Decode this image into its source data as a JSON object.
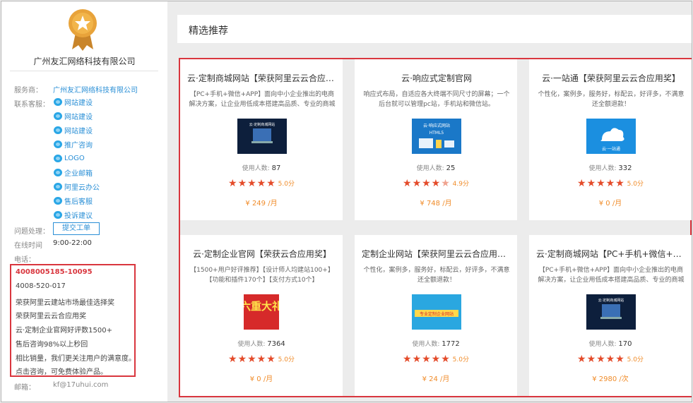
{
  "sidebar": {
    "company_name": "广州友汇网络科技有限公司",
    "provider_label": "服务商：",
    "provider_value": "广州友汇网络科技有限公司",
    "support_label": "联系客服：",
    "support_items": [
      "网站建设",
      "网站建设",
      "网站建设",
      "推广咨询",
      "LOGO",
      "企业邮箱",
      "阿里云办公",
      "售后客服",
      "投诉建议"
    ],
    "issue_label": "问题处理：",
    "ticket_button": "提交工单",
    "online_label": "在线时间",
    "online_value": "9:00-22:00",
    "phone_label": "电话：",
    "phone_lines": [
      "4008005185-10095",
      "4008-520-017",
      "荣获阿里云建站市场最佳选择奖",
      "荣获阿里云云合应用奖",
      "云·定制企业官网好评数1500+",
      "售后咨询98%以上秒回",
      "相比销量，我们更关注用户的满意度。",
      "点击咨询，可免费体验产品。"
    ],
    "email_label": "邮箱：",
    "email_value": "kf@17uhui.com"
  },
  "main": {
    "title": "精选推荐",
    "users_label": "使用人数:",
    "products": [
      {
        "title": "云·定制商城网站【荣获阿里云云合应用奖】",
        "desc": "【PC+手机+微信+APP】面向中小企业推出的电商解决方案，让企业用低成本搭建高品质、专业的商城",
        "users": "87",
        "score": "5.0分",
        "price": "¥ 249 /月",
        "rating": 5.0,
        "img_text": "云·定制商城网站"
      },
      {
        "title": "云·响应式定制官网",
        "desc": "响应式布局，自适应各大终端不同尺寸的屏幕；一个后台就可以管理pc站，手机站和微信站。",
        "users": "25",
        "score": "4.9分",
        "price": "¥ 748 /月",
        "rating": 4.9,
        "img_text": "云·响应式网站",
        "img_sub": "HTML5"
      },
      {
        "title": "云·一站通【荣获阿里云云合应用奖】",
        "desc": "个性化，案例多，服务好，标配云，好评多，不满意还全额退款！",
        "users": "332",
        "score": "5.0分",
        "price": "¥ 0 /月",
        "rating": 5.0,
        "img_text": "云·一站通"
      },
      {
        "title": "云·定制企业官网【荣获云合应用奖】",
        "desc": "【1500+用户好评推荐】【设计师人均建站100+】【功能和插件170个】【支付方式10个】",
        "users": "7364",
        "score": "5.0分",
        "price": "¥ 0 /月",
        "rating": 5.0,
        "img_text": "六重大礼"
      },
      {
        "title": "定制企业网站【荣获阿里云云合应用奖】",
        "desc": "个性化，案例多，服务好，标配云，好评多，不满意还全额退款！",
        "users": "1772",
        "score": "5.0分",
        "price": "¥ 24 /月",
        "rating": 5.0,
        "img_text": "专业定制企业网站"
      },
      {
        "title": "云·定制商城网站【PC+手机+微信+APP】",
        "desc": "【PC+手机+微信+APP】面向中小企业推出的电商解决方案，让企业用低成本搭建高品质、专业的商城",
        "users": "170",
        "score": "5.0分",
        "price": "¥ 2980 /次",
        "rating": 5.0,
        "img_text": "云·定制商城网站"
      }
    ]
  },
  "colors": {
    "accent_red": "#d9363e",
    "link_blue": "#2a8fd6",
    "price_orange": "#f08c2a",
    "star_red": "#e44b2a",
    "medal_gold": "#e8a33a"
  }
}
